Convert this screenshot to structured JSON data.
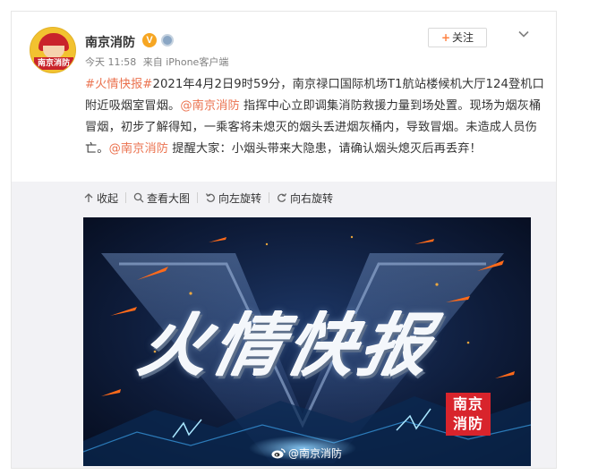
{
  "post": {
    "author": "南京消防",
    "verified_badge": "V",
    "time": "今天 11:58",
    "source": "来自 iPhone客户端",
    "follow_plus": "+",
    "follow_label": "关注",
    "avatar_text": "南京消防",
    "text": {
      "hashtag": "#火情快报#",
      "part1": "2021年4月2日9时59分，南京禄口国际机场T1航站楼候机大厅124登机口附近吸烟室冒烟。",
      "mention1": "@南京消防",
      "part2": " 指挥中心立即调集消防救援力量到场处置。现场为烟灰桶冒烟，初步了解得知，一乘客将未熄灭的烟头丢进烟灰桶内，导致冒烟。未造成人员伤亡。",
      "mention2": "@南京消防",
      "part3": " 提醒大家：小烟头带来大隐患，请确认烟头熄灭后再丢弃！"
    }
  },
  "media_toolbar": {
    "collapse": "收起",
    "view_large": "查看大图",
    "rotate_left": "向左旋转",
    "rotate_right": "向右旋转"
  },
  "image": {
    "title": "火情快报",
    "stamp_line1": "南京",
    "stamp_line2": "消防",
    "watermark": "@南京消防"
  },
  "colors": {
    "link": "#eb7350",
    "follow_plus": "#ff8140",
    "verified": "#f6a623",
    "stamp": "#d8242c"
  },
  "icons": {
    "collapse": "arrow-up-icon",
    "view_large": "magnifier-icon",
    "rotate_left": "rotate-left-icon",
    "rotate_right": "rotate-right-icon",
    "more": "chevron-down-icon",
    "weibo": "weibo-logo-icon"
  }
}
